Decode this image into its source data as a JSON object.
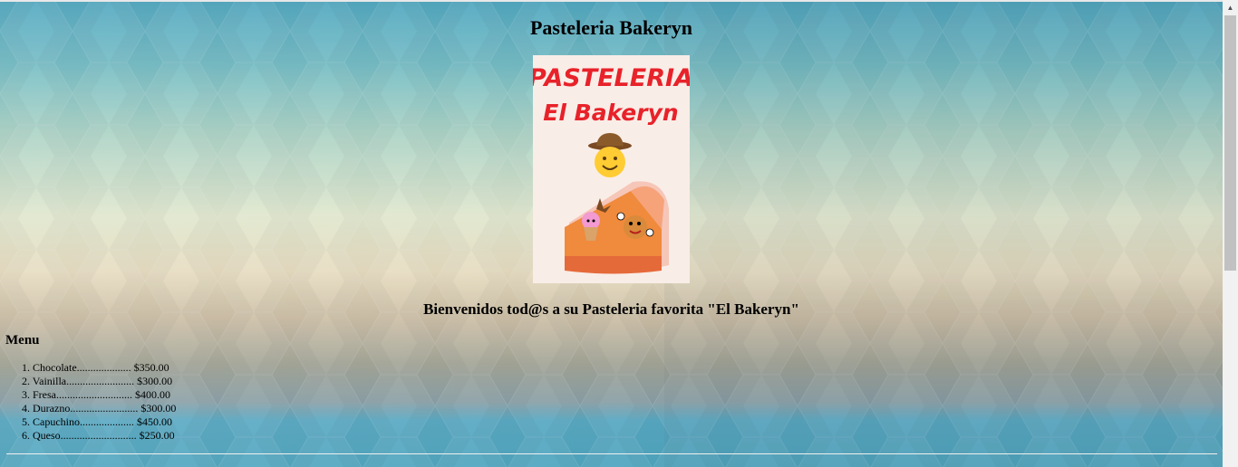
{
  "page": {
    "title": "Pasteleria Bakeryn",
    "welcome": "Bienvenidos tod@s a su Pasteleria favorita \"El Bakeryn\""
  },
  "logo": {
    "line1": "PASTELERIA",
    "line2": "El Bakeryn",
    "colors": {
      "text": "#e8222a",
      "background": "#f9ede7",
      "pie": "#f08a3c"
    }
  },
  "menu": {
    "heading": "Menu",
    "items": [
      {
        "label": "1. Chocolate.................... $350.00"
      },
      {
        "label": "2. Vainilla......................... $300.00"
      },
      {
        "label": "3. Fresa............................ $400.00"
      },
      {
        "label": "4. Durazno......................... $300.00"
      },
      {
        "label": "5. Capuchino.................... $450.00"
      },
      {
        "label": "6. Queso............................ $250.00"
      }
    ]
  }
}
